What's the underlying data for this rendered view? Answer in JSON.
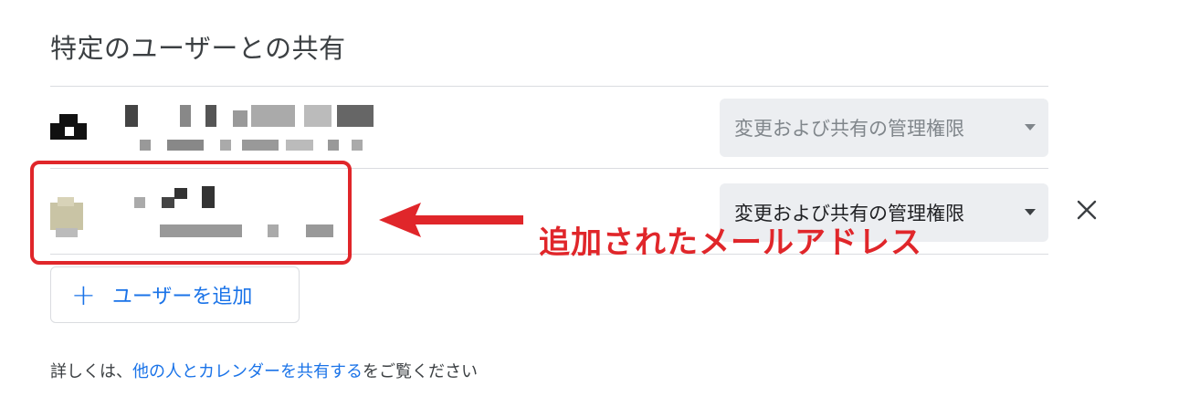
{
  "section": {
    "title": "特定のユーザーとの共有"
  },
  "users": [
    {
      "role": "変更および共有の管理権限",
      "role_enabled": false,
      "removable": false
    },
    {
      "role": "変更および共有の管理権限",
      "role_enabled": true,
      "removable": true
    }
  ],
  "add_user": {
    "label": "ユーザーを追加",
    "icon": "plus-icon"
  },
  "remove": {
    "icon": "close-icon"
  },
  "help": {
    "prefix": "詳しくは、",
    "link": "他の人とカレンダーを共有する",
    "suffix": "をご覧ください"
  },
  "annotation": {
    "text": "追加されたメールアドレス"
  },
  "colors": {
    "accent": "#1a73e8",
    "annotation_red": "#e0262a",
    "divider": "#dadce0"
  }
}
